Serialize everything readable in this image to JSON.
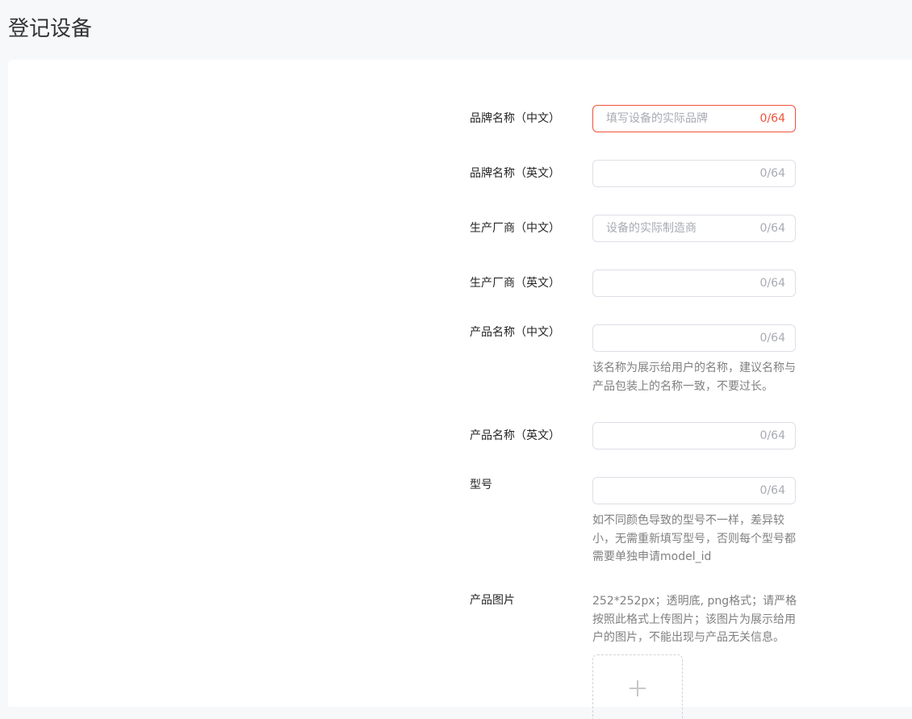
{
  "page": {
    "title": "登记设备"
  },
  "form": {
    "brand_cn": {
      "label": "品牌名称（中文）",
      "placeholder": "填写设备的实际品牌",
      "count": "0/64"
    },
    "brand_en": {
      "label": "品牌名称（英文）",
      "placeholder": "",
      "count": "0/64"
    },
    "maker_cn": {
      "label": "生产厂商（中文）",
      "placeholder": "设备的实际制造商",
      "count": "0/64"
    },
    "maker_en": {
      "label": "生产厂商（英文）",
      "placeholder": "",
      "count": "0/64"
    },
    "product_cn": {
      "label": "产品名称（中文）",
      "placeholder": "",
      "count": "0/64",
      "hint_line1": "该名称为展示给用户的名称，建议名称与",
      "hint_line2": "产品包装上的名称一致，不要过长。"
    },
    "product_en": {
      "label": "产品名称（英文）",
      "placeholder": "",
      "count": "0/64"
    },
    "model": {
      "label": "型号",
      "placeholder": "",
      "count": "0/64",
      "hint_line1": "如不同颜色导致的型号不一样，差异较",
      "hint_line2": "小，无需重新填写型号，否则每个型号都",
      "hint_line3": "需要单独申请model_id"
    },
    "image": {
      "label": "产品图片",
      "hint_line1": "252*252px；透明底, png格式；请严格",
      "hint_line2": "按照此格式上传图片；该图片为展示给用",
      "hint_line3": "户的图片，不能出现与产品无关信息。",
      "upload_icon": "plus-icon"
    }
  },
  "colors": {
    "error": "#f0533a",
    "border": "#dcdfe6",
    "placeholder": "#a8abb2"
  }
}
